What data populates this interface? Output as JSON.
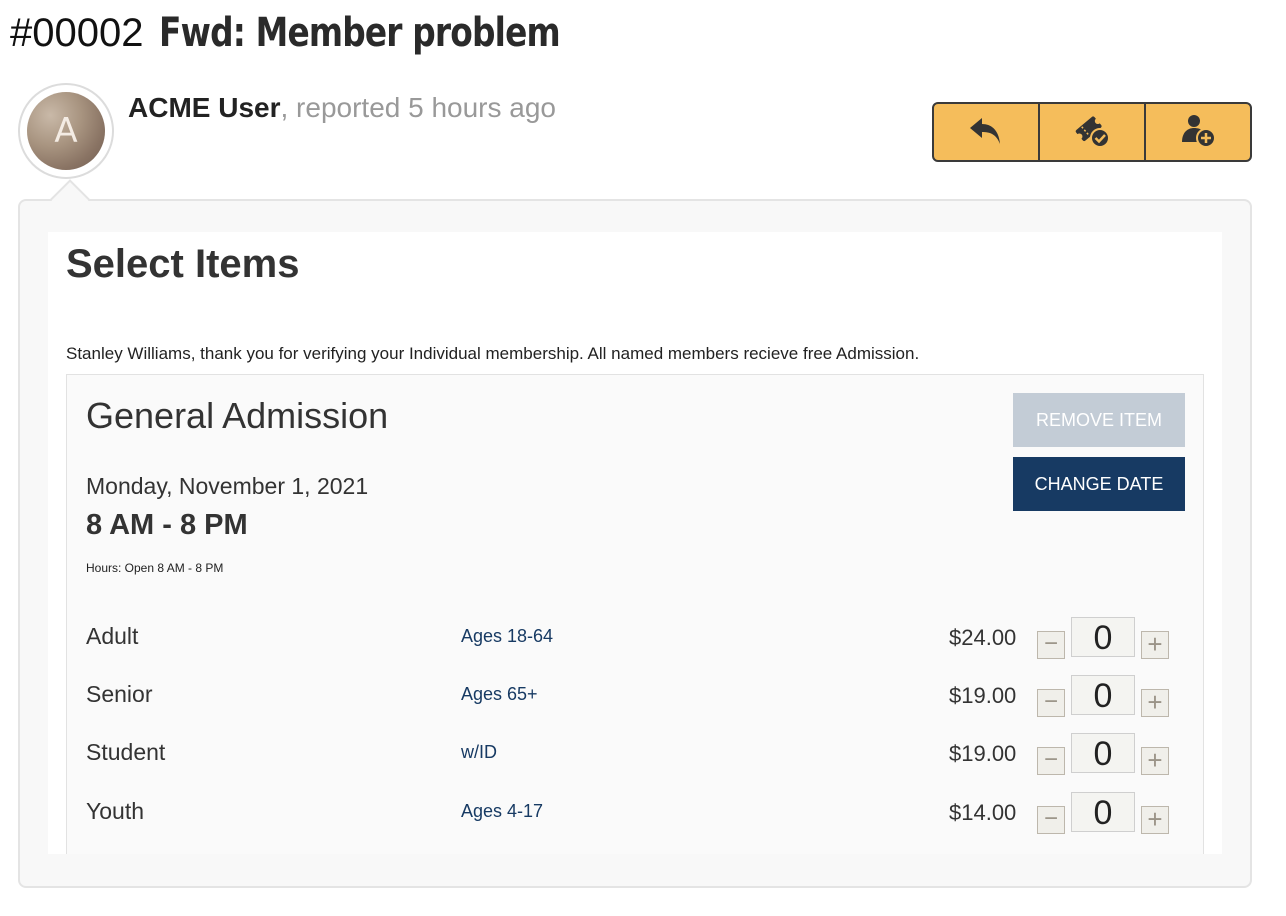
{
  "ticket": {
    "id": "#00002",
    "title": "Fwd: Member problem"
  },
  "byline": {
    "avatar_initial": "A",
    "author": "ACME User",
    "separator": ",",
    "meta": " reported 5 hours ago"
  },
  "actions": [
    {
      "icon": "reply-icon"
    },
    {
      "icon": "ticket-resolve-icon"
    },
    {
      "icon": "assign-user-icon"
    }
  ],
  "embedded": {
    "title": "Select Items",
    "verify_message": "Stanley Williams, thank you for verifying your Individual membership. All named members recieve free Admission.",
    "admission": {
      "title": "General Admission",
      "date": "Monday, November 1, 2021",
      "time": "8 AM - 8 PM",
      "hours": "Hours: Open 8 AM - 8 PM",
      "remove_label": "REMOVE ITEM",
      "change_date_label": "CHANGE DATE",
      "tickets": [
        {
          "name": "Adult",
          "desc": "Ages 18-64",
          "price": "$24.00",
          "qty": "0"
        },
        {
          "name": "Senior",
          "desc": "Ages 65+",
          "price": "$19.00",
          "qty": "0"
        },
        {
          "name": "Student",
          "desc": "w/ID",
          "price": "$19.00",
          "qty": "0"
        },
        {
          "name": "Youth",
          "desc": "Ages 4-17",
          "price": "$14.00",
          "qty": "0"
        }
      ],
      "minus_symbol": "−",
      "plus_symbol": "+"
    }
  },
  "colors": {
    "action_bg": "#f5bd5b",
    "primary_button": "#173a63",
    "disabled_button": "#c3ccd6",
    "link_text": "#173a63"
  }
}
